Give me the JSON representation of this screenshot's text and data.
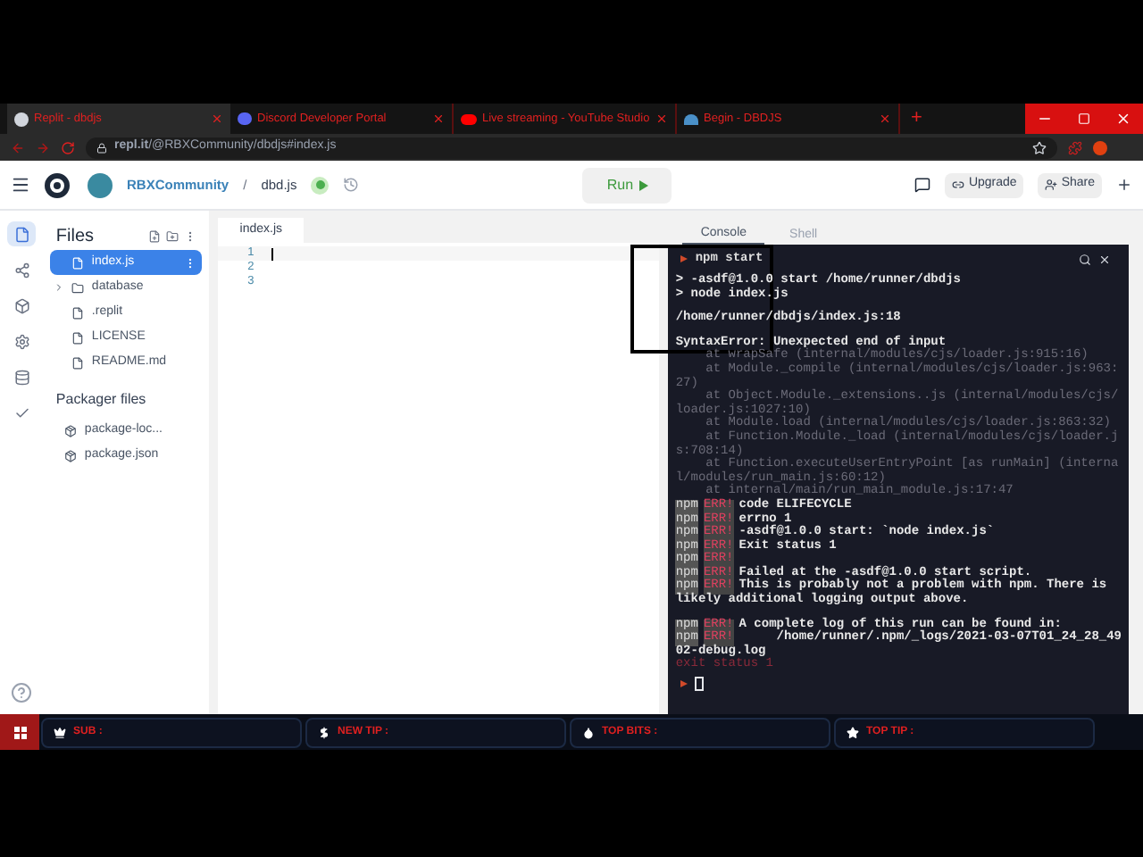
{
  "browser": {
    "tabs": [
      {
        "title": "Replit - dbdjs",
        "selected": true
      },
      {
        "title": "Discord Developer Portal",
        "selected": false
      },
      {
        "title": "Live streaming - YouTube Studio",
        "selected": false
      },
      {
        "title": "Begin - DBDJS",
        "selected": false
      }
    ],
    "new_tab": "+",
    "url": "**repl.it**/@RBXCommunity/dbdjs#index.js"
  },
  "header": {
    "owner": "RBXCommunity",
    "separator": "/",
    "repl": "dbd.js",
    "run": "Run",
    "upgrade": "Upgrade",
    "share": "Share"
  },
  "rail": [
    {
      "kind": "files",
      "selected": true
    },
    {
      "kind": "share",
      "selected": false
    },
    {
      "kind": "packages",
      "selected": false
    },
    {
      "kind": "settings",
      "selected": false
    },
    {
      "kind": "database",
      "selected": false
    },
    {
      "kind": "check",
      "selected": false
    }
  ],
  "files": {
    "title": "Files",
    "items": [
      {
        "name": "index.js",
        "kind": "file",
        "selected": true
      },
      {
        "name": "database",
        "kind": "folder",
        "expanded": false,
        "selected": false
      },
      {
        "name": ".replit",
        "kind": "file",
        "selected": false
      },
      {
        "name": "LICENSE",
        "kind": "file",
        "selected": false
      },
      {
        "name": "README.md",
        "kind": "file",
        "selected": false
      }
    ],
    "packager_title": "Packager files",
    "packager": [
      {
        "name": "package-loc..."
      },
      {
        "name": "package.json"
      }
    ]
  },
  "editor": {
    "tab": "index.js",
    "lines": [
      "1",
      "2",
      "3"
    ]
  },
  "console": {
    "tabs": [
      {
        "label": "Console",
        "selected": true
      },
      {
        "label": "Shell",
        "selected": false
      }
    ],
    "command": "npm start",
    "log": [
      {
        "kind": "out",
        "text": "> -asdf@1.0.0 start /home/runner/dbdjs",
        "spaced": false
      },
      {
        "kind": "out",
        "text": "> node index.js",
        "spaced": false
      },
      {
        "kind": "out",
        "text": "/home/runner/dbdjs/index.js:18",
        "spaced": true
      },
      {
        "kind": "out",
        "text": "SyntaxError: Unexpected end of input",
        "spaced": true
      },
      {
        "kind": "trace",
        "text": "    at wrapSafe (internal/modules/cjs/loader.js:915:16)",
        "spaced": false
      },
      {
        "kind": "trace",
        "text": "    at Module._compile (internal/modules/cjs/loader.js:963:",
        "spaced": false
      },
      {
        "kind": "trace",
        "text": "27)",
        "spaced": false
      },
      {
        "kind": "trace",
        "text": "    at Object.Module._extensions..js (internal/modules/cjs/",
        "spaced": false
      },
      {
        "kind": "trace",
        "text": "loader.js:1027:10)",
        "spaced": false
      },
      {
        "kind": "trace",
        "text": "    at Module.load (internal/modules/cjs/loader.js:863:32)",
        "spaced": false
      },
      {
        "kind": "trace",
        "text": "    at Function.Module._load (internal/modules/cjs/loader.j",
        "spaced": false
      },
      {
        "kind": "trace",
        "text": "s:708:14)",
        "spaced": false
      },
      {
        "kind": "trace",
        "text": "    at Function.executeUserEntryPoint [as runMain] (interna",
        "spaced": false
      },
      {
        "kind": "trace",
        "text": "l/modules/run_main.js:60:12)",
        "spaced": false
      },
      {
        "kind": "trace",
        "text": "    at internal/main/run_main_module.js:17:47",
        "spaced": false
      },
      {
        "kind": "npm",
        "tag": "npm",
        "err": "ERR!",
        "text": "code ELIFECYCLE",
        "spaced": false
      },
      {
        "kind": "npm",
        "tag": "npm",
        "err": "ERR!",
        "text": "errno 1",
        "spaced": false
      },
      {
        "kind": "npm",
        "tag": "npm",
        "err": "ERR!",
        "text": "-asdf@1.0.0 start: `node index.js`",
        "spaced": false
      },
      {
        "kind": "npm",
        "tag": "npm",
        "err": "ERR!",
        "text": "Exit status 1",
        "spaced": false
      },
      {
        "kind": "npm",
        "tag": "npm",
        "err": "ERR!",
        "spaced": false
      },
      {
        "kind": "npm",
        "tag": "npm",
        "err": "ERR!",
        "text": "Failed at the -asdf@1.0.0 start script.",
        "spaced": false
      },
      {
        "kind": "npm",
        "tag": "npm",
        "err": "ERR!",
        "text": "This is probably not a problem with npm. There is",
        "spaced": false
      },
      {
        "kind": "out",
        "text": "likely additional logging output above.",
        "spaced": false
      },
      {
        "kind": "npm",
        "tag": "npm",
        "err": "ERR!",
        "text": "A complete log of this run can be found in:",
        "spaced": true
      },
      {
        "kind": "npm",
        "tag": "npm",
        "err": "ERR!",
        "text": "     /home/runner/.npm/_logs/2021-03-07T01_24_28_49",
        "spaced": false
      },
      {
        "kind": "out",
        "text": "02-debug.log",
        "spaced": false
      },
      {
        "kind": "exit",
        "text": "exit status 1",
        "spaced": false
      }
    ]
  },
  "taskbar": {
    "widgets": [
      {
        "label": "SUB :"
      },
      {
        "label": "NEW TIP :"
      },
      {
        "label": "TOP BITS :"
      },
      {
        "label": "TOP TIP :"
      }
    ]
  }
}
